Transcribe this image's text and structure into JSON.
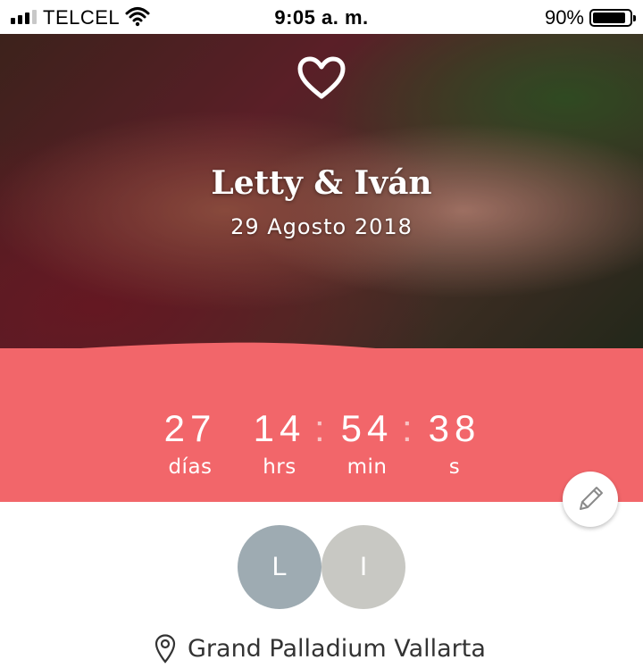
{
  "status_bar": {
    "carrier": "TELCEL",
    "time": "9:05 a. m.",
    "battery": "90%",
    "battery_level": 0.9,
    "signal_bars": 3
  },
  "hero": {
    "icon": "heart-outline-icon",
    "names": "Letty & Iván",
    "date": "29 Agosto 2018"
  },
  "countdown": {
    "days": {
      "value": "27",
      "label": "días"
    },
    "hours": {
      "value": "14",
      "label": "hrs"
    },
    "minutes": {
      "value": "54",
      "label": "min"
    },
    "seconds": {
      "value": "38",
      "label": "s"
    },
    "separator": ":"
  },
  "edit": {
    "icon": "pencil-icon"
  },
  "avatars": [
    {
      "initial": "L",
      "color": "#9eabb2"
    },
    {
      "initial": "I",
      "color": "#c8c8c3"
    }
  ],
  "venue": {
    "icon": "location-pin-icon",
    "name": "Grand Palladium Vallarta"
  },
  "colors": {
    "accent": "#f2666a",
    "white": "#ffffff",
    "text": "#333333"
  }
}
